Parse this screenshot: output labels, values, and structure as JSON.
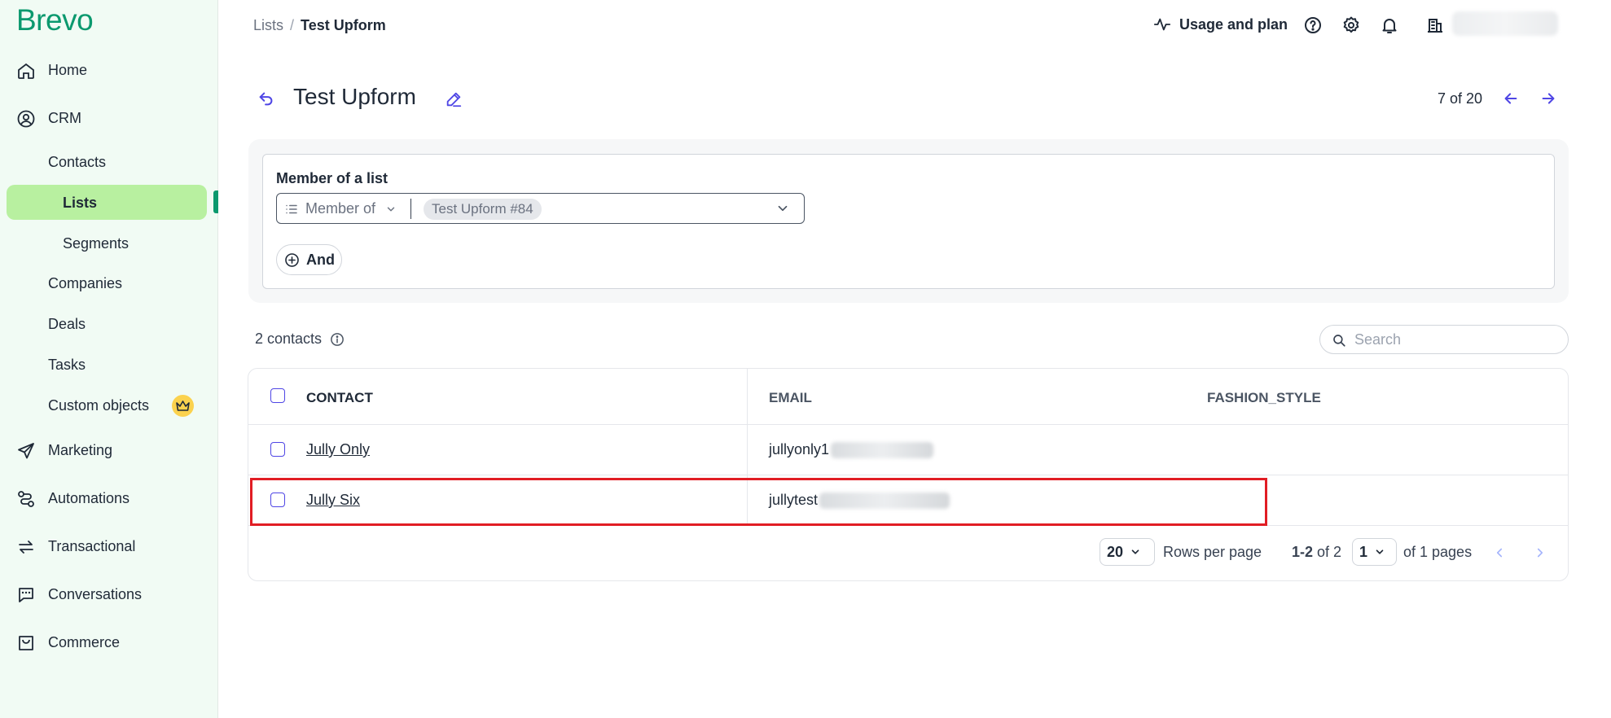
{
  "app": {
    "logo": "Brevo"
  },
  "sidebar": {
    "home": "Home",
    "crm": "CRM",
    "contacts": "Contacts",
    "lists": "Lists",
    "segments": "Segments",
    "companies": "Companies",
    "deals": "Deals",
    "tasks": "Tasks",
    "custom_objects": "Custom objects",
    "marketing": "Marketing",
    "automations": "Automations",
    "transactional": "Transactional",
    "conversations": "Conversations",
    "commerce": "Commerce"
  },
  "header": {
    "breadcrumb_parent": "Lists",
    "breadcrumb_sep": "/",
    "breadcrumb_current": "Test Upform",
    "usage_label": "Usage and plan"
  },
  "page": {
    "title": "Test Upform",
    "pager": "7 of 20"
  },
  "filter": {
    "label": "Member of a list",
    "operator": "Member of",
    "value_tag": "Test Upform #84",
    "and_label": "And"
  },
  "contacts": {
    "count": "2 contacts",
    "search_placeholder": "Search"
  },
  "table": {
    "columns": [
      "CONTACT",
      "EMAIL",
      "FASHION_STYLE"
    ],
    "rows": [
      {
        "name": "Jully Only",
        "email_visible": "jullyonly1"
      },
      {
        "name": "Jully Six",
        "email_visible": "jullytest"
      }
    ]
  },
  "pagination": {
    "rows_per_page_value": "20",
    "rows_per_page_label": "Rows per page",
    "range_bold": "1-2",
    "range_rest": "of 2",
    "page_value": "1",
    "pages_label": "of 1 pages"
  },
  "colors": {
    "brand": "#0b996e",
    "active_nav": "#b8f0a0",
    "accent": "#4f46e5",
    "highlight": "#e11d24"
  }
}
